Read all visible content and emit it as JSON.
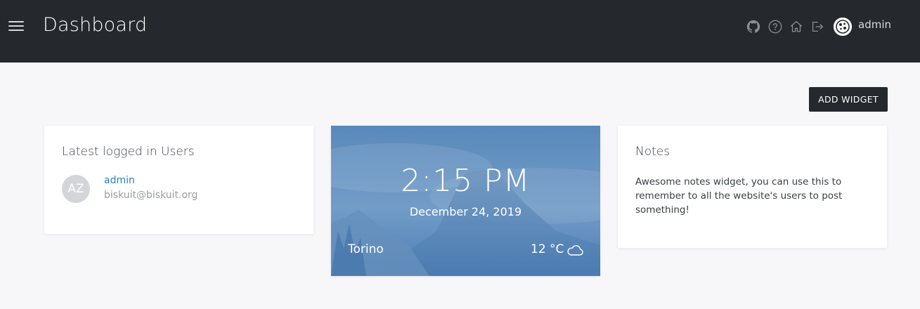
{
  "header": {
    "title": "Dashboard",
    "username": "admin",
    "icons": [
      "menu-icon",
      "github-icon",
      "help-icon",
      "home-icon",
      "logout-icon",
      "user-avatar-icon"
    ],
    "background": "#25282d"
  },
  "toolbar": {
    "add_widget_label": "ADD WIDGET"
  },
  "users_widget": {
    "title": "Latest logged in Users",
    "users": [
      {
        "initials": "AZ",
        "name": "admin",
        "email": "biskuit@biskuit.org"
      }
    ]
  },
  "clock_widget": {
    "time": "2:15 PM",
    "date": "December 24, 2019",
    "city": "Torino",
    "temperature": "12 °C",
    "weather_icon": "cloud-icon"
  },
  "notes_widget": {
    "title": "Notes",
    "text": "Awesome notes widget, you can use this to remember to all the website's users to post something!"
  },
  "colors": {
    "accent_link": "#2f7fc1",
    "page_bg": "#f7f7f9"
  }
}
